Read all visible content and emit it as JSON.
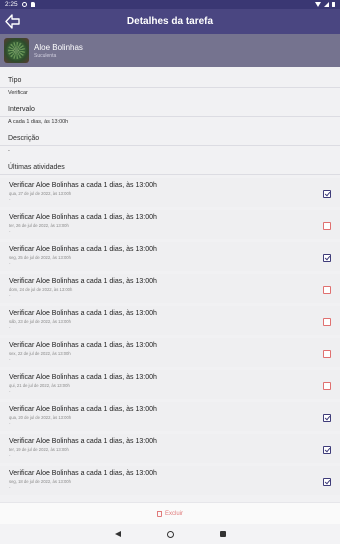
{
  "status_bar": {
    "time": "2:25"
  },
  "app_bar": {
    "title": "Detalhes da tarefa"
  },
  "plant": {
    "name": "Aloe Bolinhas",
    "type": "Suculenta"
  },
  "fields": [
    {
      "label": "Tipo",
      "value": "Verificar"
    },
    {
      "label": "Intervalo",
      "value": "A cada 1 dias, às 13:00h"
    },
    {
      "label": "Descrição",
      "value": "-"
    }
  ],
  "activities_label": "Últimas atividades",
  "activities": [
    {
      "title": "Verificar Aloe Bolinhas a cada 1 dias, às 13:00h",
      "date": "qua, 27 de jul de 2022, às 13:00h",
      "note": "-",
      "done": true
    },
    {
      "title": "Verificar Aloe Bolinhas a cada 1 dias, às 13:00h",
      "date": "ter, 26 de jul de 2022, às 13:00h",
      "note": "-",
      "done": false
    },
    {
      "title": "Verificar Aloe Bolinhas a cada 1 dias, às 13:00h",
      "date": "seg, 25 de jul de 2022, às 13:00h",
      "note": "-",
      "done": true
    },
    {
      "title": "Verificar Aloe Bolinhas a cada 1 dias, às 13:00h",
      "date": "dom, 24 de jul de 2022, às 13:00h",
      "note": "-",
      "done": false
    },
    {
      "title": "Verificar Aloe Bolinhas a cada 1 dias, às 13:00h",
      "date": "sáb, 23 de jul de 2022, às 13:00h",
      "note": "-",
      "done": false
    },
    {
      "title": "Verificar Aloe Bolinhas a cada 1 dias, às 13:00h",
      "date": "sex, 22 de jul de 2022, às 13:00h",
      "note": "-",
      "done": false
    },
    {
      "title": "Verificar Aloe Bolinhas a cada 1 dias, às 13:00h",
      "date": "qui, 21 de jul de 2022, às 13:00h",
      "note": "-",
      "done": false
    },
    {
      "title": "Verificar Aloe Bolinhas a cada 1 dias, às 13:00h",
      "date": "qua, 20 de jul de 2022, às 13:00h",
      "note": "-",
      "done": true
    },
    {
      "title": "Verificar Aloe Bolinhas a cada 1 dias, às 13:00h",
      "date": "ter, 19 de jul de 2022, às 13:00h",
      "note": "-",
      "done": true
    },
    {
      "title": "Verificar Aloe Bolinhas a cada 1 dias, às 13:00h",
      "date": "seg, 18 de jul de 2022, às 13:00h",
      "note": "-",
      "done": true
    }
  ],
  "delete_label": "Excluir",
  "colors": {
    "primary": "#4a4681",
    "header": "#75738f",
    "checked": "#3f3c7a",
    "unchecked": "#e07070",
    "danger": "#e07a7a"
  }
}
